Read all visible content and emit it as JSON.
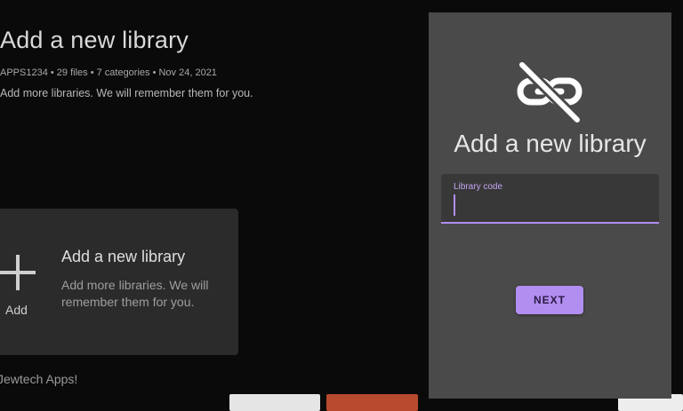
{
  "background": {
    "title": "Add a new library",
    "meta": "APPS1234 • 29 files • 7 categories • Nov 24, 2021",
    "description": "Add more libraries. We will remember them for you.",
    "card": {
      "icon": "plus-icon",
      "add_label": "Add",
      "title": "Add a new library",
      "description": "Add more libraries. We will remember them for you."
    },
    "row_label": "Jewtech Apps!"
  },
  "dialog": {
    "icon": "link-off-icon",
    "title": "Add a new library",
    "field": {
      "label": "Library code",
      "value": ""
    },
    "next_label": "NEXT"
  },
  "colors": {
    "accent": "#b28ef0",
    "panel": "#4a4a4a",
    "background": "#0a0a0a"
  }
}
